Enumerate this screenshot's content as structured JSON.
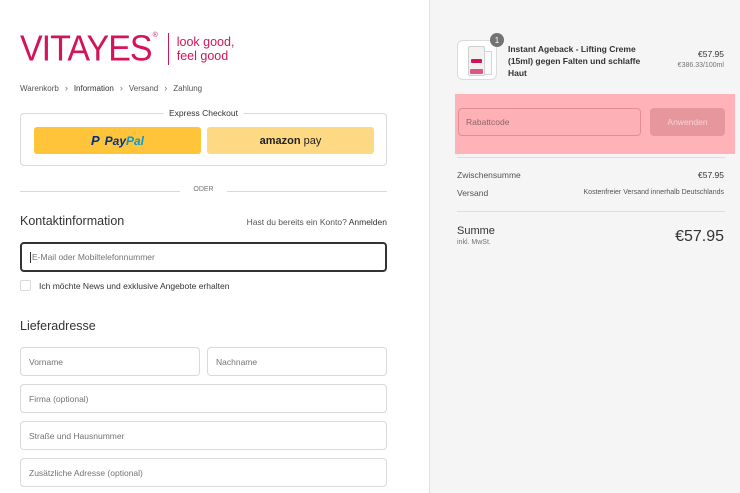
{
  "brand": {
    "name": "VITAYES",
    "registered": "®",
    "tagline_line1": "look good,",
    "tagline_line2": "feel good",
    "color": "#d4145a"
  },
  "breadcrumb": {
    "items": [
      "Warenkorb",
      "Information",
      "Versand",
      "Zahlung"
    ],
    "active": "Information",
    "separator_icon": "chevron-right-icon"
  },
  "express_checkout": {
    "title": "Express Checkout",
    "paypal": {
      "part1": "Pay",
      "part2": "Pal",
      "color": "#ffc439"
    },
    "amazon": {
      "part1": "amazon",
      "part2": "pay",
      "color": "#fcd982"
    }
  },
  "divider_text": "ODER",
  "contact": {
    "title": "Kontaktinformation",
    "login_prompt": "Hast du bereits ein Konto?",
    "login_link": "Anmelden",
    "email_placeholder": "E-Mail oder Mobiltelefonnummer",
    "newsletter_label": "Ich möchte News und exklusive Angebote erhalten"
  },
  "shipping": {
    "title": "Lieferadresse",
    "firstname_placeholder": "Vorname",
    "lastname_placeholder": "Nachname",
    "company_placeholder": "Firma (optional)",
    "street_placeholder": "Straße und Hausnummer",
    "address2_placeholder": "Zusätzliche Adresse (optional)"
  },
  "order": {
    "item": {
      "quantity": "1",
      "name": "Instant Ageback - Lifting Creme (15ml) gegen Falten und schlaffe Haut",
      "price": "€57.95",
      "unit_price": "€386.33/100ml"
    },
    "discount": {
      "placeholder": "Rabattcode",
      "button": "Anwenden",
      "highlight_color": "#ffb3b8"
    },
    "subtotal_label": "Zwischensumme",
    "subtotal_value": "€57.95",
    "shipping_label": "Versand",
    "shipping_value": "Kostenfreier Versand innerhalb Deutschlands",
    "total_label": "Summe",
    "total_sub": "inkl. MwSt.",
    "total_value": "€57.95"
  }
}
